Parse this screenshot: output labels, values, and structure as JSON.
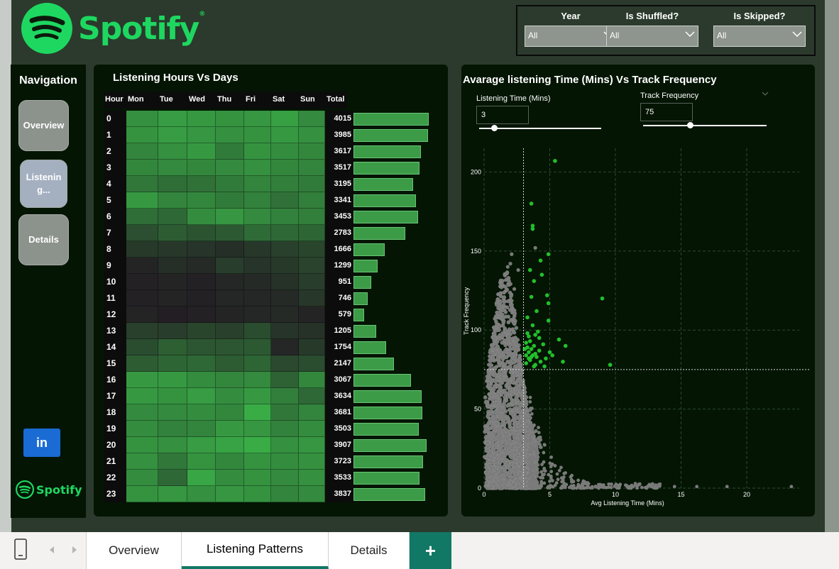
{
  "brand": {
    "name": "Spotify",
    "mini_name": "Spotify"
  },
  "filters": [
    {
      "label": "Year",
      "value": "All"
    },
    {
      "label": "Is Shuffled?",
      "value": "All"
    },
    {
      "label": "Is Skipped?",
      "value": "All"
    }
  ],
  "navigation": {
    "title": "Navigation",
    "items": [
      {
        "label": "Overview",
        "active": false
      },
      {
        "label": "Listenin g...",
        "active": true
      },
      {
        "label": "Details",
        "active": false
      }
    ],
    "linkedin_label": "in"
  },
  "heatmap": {
    "title": "Listening Hours Vs Days",
    "columns": [
      "Hour",
      "Mon",
      "Tue",
      "Wed",
      "Thu",
      "Fri",
      "Sat",
      "Sun",
      "Total"
    ]
  },
  "scatter": {
    "title": "Avarage listening Time (Mins) Vs Track Frequency",
    "params": [
      {
        "label": "Listening Time (Mins)",
        "value": "3",
        "slider_fraction": 0.12
      },
      {
        "label": "Track Frequency",
        "value": "75",
        "slider_fraction": 0.38
      }
    ]
  },
  "chart_data": [
    {
      "type": "heatmap",
      "title": "Listening Hours Vs Days",
      "x": [
        "Mon",
        "Tue",
        "Wed",
        "Thu",
        "Fri",
        "Sat",
        "Sun"
      ],
      "y": [
        0,
        1,
        2,
        3,
        4,
        5,
        6,
        7,
        8,
        9,
        10,
        11,
        12,
        13,
        14,
        15,
        16,
        17,
        18,
        19,
        20,
        21,
        22,
        23
      ],
      "totals": [
        4015,
        3985,
        3617,
        3517,
        3195,
        3341,
        3453,
        2783,
        1666,
        1299,
        951,
        746,
        579,
        1205,
        1754,
        2147,
        3067,
        3634,
        3681,
        3503,
        3907,
        3723,
        3533,
        3837
      ],
      "values": [
        [
          0.78,
          0.86,
          0.84,
          0.8,
          0.82,
          0.88,
          0.74
        ],
        [
          0.8,
          0.86,
          0.82,
          0.78,
          0.8,
          0.84,
          0.78
        ],
        [
          0.7,
          0.78,
          0.84,
          0.64,
          0.8,
          0.76,
          0.72
        ],
        [
          0.72,
          0.74,
          0.72,
          0.74,
          0.78,
          0.72,
          0.7
        ],
        [
          0.62,
          0.56,
          0.58,
          0.64,
          0.7,
          0.66,
          0.64
        ],
        [
          0.84,
          0.7,
          0.72,
          0.64,
          0.68,
          0.58,
          0.66
        ],
        [
          0.56,
          0.52,
          0.76,
          0.82,
          0.74,
          0.68,
          0.66
        ],
        [
          0.36,
          0.44,
          0.38,
          0.42,
          0.54,
          0.52,
          0.5
        ],
        [
          0.22,
          0.2,
          0.18,
          0.14,
          0.2,
          0.26,
          0.3
        ],
        [
          0.08,
          0.14,
          0.12,
          0.24,
          0.18,
          0.22,
          0.28
        ],
        [
          0.06,
          0.08,
          0.06,
          0.1,
          0.12,
          0.16,
          0.24
        ],
        [
          0.06,
          0.08,
          0.06,
          0.1,
          0.1,
          0.12,
          0.2
        ],
        [
          0.08,
          0.04,
          0.06,
          0.08,
          0.1,
          0.12,
          0.08
        ],
        [
          0.26,
          0.24,
          0.3,
          0.26,
          0.34,
          0.18,
          0.16
        ],
        [
          0.34,
          0.46,
          0.4,
          0.4,
          0.42,
          0.1,
          0.22
        ],
        [
          0.44,
          0.5,
          0.52,
          0.44,
          0.5,
          0.32,
          0.34
        ],
        [
          0.84,
          0.84,
          0.76,
          0.72,
          0.74,
          0.48,
          0.72
        ],
        [
          0.84,
          0.8,
          0.86,
          0.76,
          0.84,
          0.66,
          0.52
        ],
        [
          0.74,
          0.74,
          0.76,
          0.72,
          0.96,
          0.62,
          0.7
        ],
        [
          0.76,
          0.68,
          0.7,
          0.84,
          0.82,
          0.68,
          0.76
        ],
        [
          0.8,
          0.78,
          0.86,
          0.9,
          0.96,
          0.78,
          0.82
        ],
        [
          0.78,
          0.62,
          0.8,
          0.72,
          0.8,
          0.76,
          0.78
        ],
        [
          0.76,
          0.52,
          0.92,
          0.76,
          0.8,
          0.74,
          0.78
        ],
        [
          0.8,
          0.82,
          0.78,
          0.82,
          0.8,
          0.7,
          0.74
        ]
      ]
    },
    {
      "type": "scatter",
      "title": "Avarage listening Time (Mins) Vs Track Frequency",
      "xlabel": "Avg Listening Time (Mins)",
      "ylabel": "Track Frequency",
      "xlim": [
        0,
        24
      ],
      "ylim": [
        0,
        215
      ],
      "xticks": [
        0,
        5,
        10,
        15,
        20
      ],
      "yticks": [
        0,
        50,
        100,
        150,
        200
      ],
      "ref_x": 3,
      "ref_y": 75,
      "grid": true,
      "colors": {
        "highlight": "#22c02a",
        "base": "#7a7a7a"
      },
      "highlight_points": [
        [
          5.4,
          207
        ],
        [
          3.6,
          180
        ],
        [
          3.7,
          166
        ],
        [
          3.7,
          164
        ],
        [
          4.9,
          148
        ],
        [
          4.3,
          144
        ],
        [
          3.5,
          138
        ],
        [
          4.4,
          135
        ],
        [
          3.8,
          131
        ],
        [
          9.0,
          120
        ],
        [
          4.8,
          122
        ],
        [
          4.9,
          117
        ],
        [
          3.6,
          121
        ],
        [
          4.0,
          112
        ],
        [
          3.3,
          108
        ],
        [
          3.7,
          103
        ],
        [
          4.9,
          106
        ],
        [
          3.3,
          98
        ],
        [
          3.9,
          97
        ],
        [
          3.4,
          96
        ],
        [
          4.2,
          95
        ],
        [
          3.5,
          93
        ],
        [
          5.7,
          94
        ],
        [
          3.2,
          92
        ],
        [
          3.8,
          90
        ],
        [
          4.5,
          91
        ],
        [
          6.2,
          90
        ],
        [
          3.6,
          88
        ],
        [
          4.2,
          87
        ],
        [
          3.4,
          86
        ],
        [
          5.0,
          86
        ],
        [
          3.7,
          84
        ],
        [
          4.0,
          83
        ],
        [
          3.5,
          81
        ],
        [
          4.3,
          80
        ],
        [
          3.2,
          79
        ],
        [
          6.0,
          80
        ],
        [
          9.6,
          78
        ],
        [
          3.8,
          77
        ],
        [
          4.6,
          77
        ],
        [
          3.4,
          82
        ],
        [
          3.9,
          85
        ],
        [
          3.1,
          88
        ],
        [
          4.1,
          99
        ],
        [
          3.3,
          89
        ],
        [
          3.6,
          83
        ],
        [
          4.7,
          82
        ],
        [
          3.2,
          84
        ],
        [
          3.9,
          78
        ],
        [
          5.2,
          84
        ]
      ],
      "base_points_note_count": 0
    }
  ],
  "tabs": [
    {
      "label": "Overview",
      "active": false
    },
    {
      "label": "Listening Patterns",
      "active": true
    },
    {
      "label": "Details",
      "active": false
    }
  ],
  "add_tab_label": "+"
}
